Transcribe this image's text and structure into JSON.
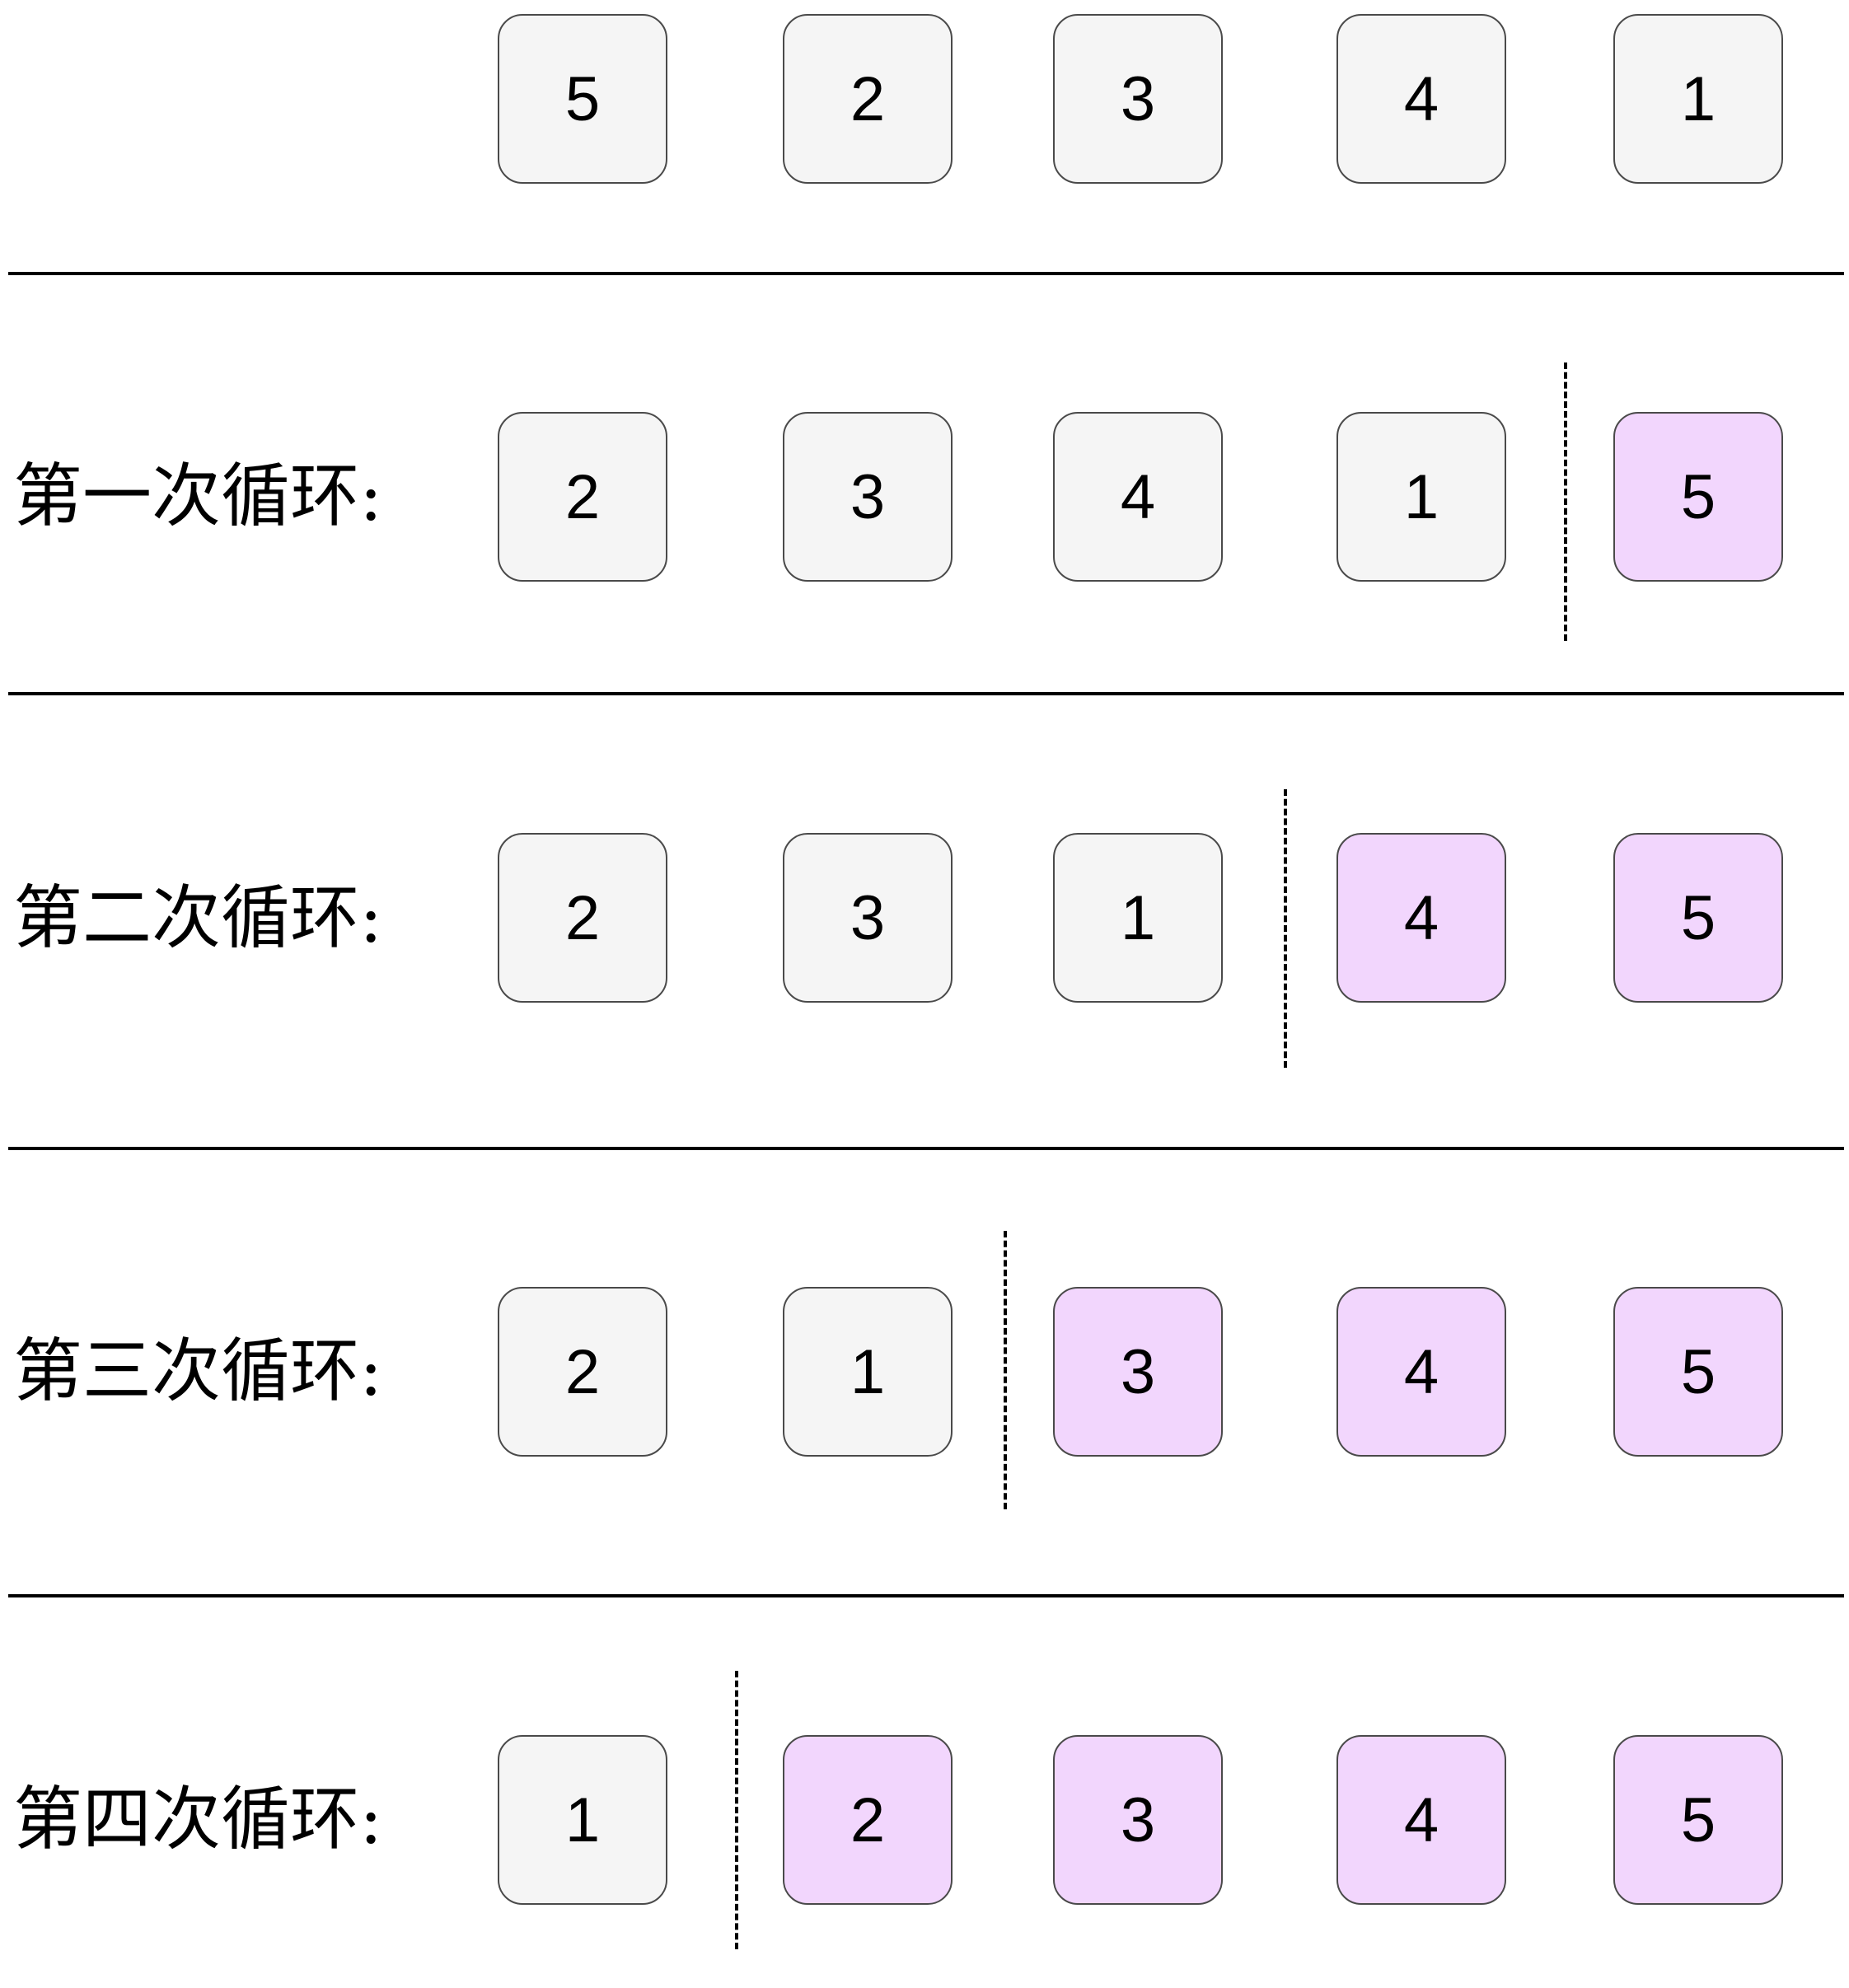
{
  "colors": {
    "unsorted_fill": "#f5f5f5",
    "sorted_fill": "#f2d6fd",
    "box_border": "#4a4a4a"
  },
  "rows": [
    {
      "label": "",
      "values": [
        "5",
        "2",
        "3",
        "4",
        "1"
      ],
      "sorted_count": 0
    },
    {
      "label": "第一次循环:",
      "values": [
        "2",
        "3",
        "4",
        "1",
        "5"
      ],
      "sorted_count": 1
    },
    {
      "label": "第二次循环:",
      "values": [
        "2",
        "3",
        "1",
        "4",
        "5"
      ],
      "sorted_count": 2
    },
    {
      "label": "第三次循环:",
      "values": [
        "2",
        "1",
        "3",
        "4",
        "5"
      ],
      "sorted_count": 3
    },
    {
      "label": "第四次循环:",
      "values": [
        "1",
        "2",
        "3",
        "4",
        "5"
      ],
      "sorted_count": 4
    }
  ]
}
